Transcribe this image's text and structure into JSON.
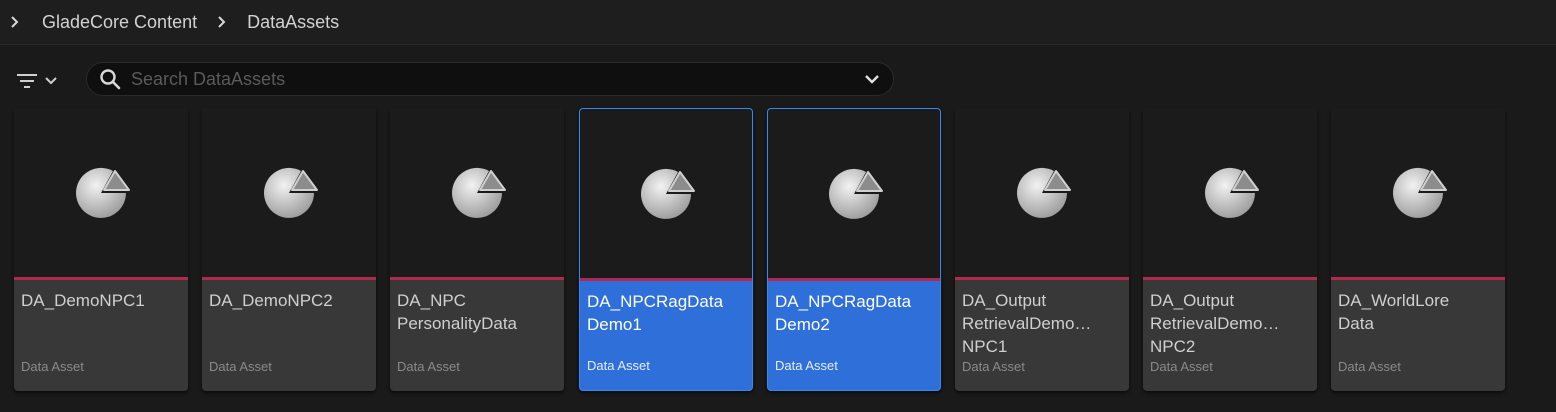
{
  "breadcrumb": {
    "items": [
      "GladeCore Content",
      "DataAssets"
    ]
  },
  "search": {
    "placeholder": "Search DataAssets",
    "value": ""
  },
  "colors": {
    "selected": "#2f6fda",
    "type_bar": "#b2294f",
    "tile_bg": "#383838"
  },
  "assets": [
    {
      "name": "DA_DemoNPC1",
      "type": "Data Asset",
      "selected": false
    },
    {
      "name": "DA_DemoNPC2",
      "type": "Data Asset",
      "selected": false
    },
    {
      "name": "DA_NPC\nPersonalityData",
      "type": "Data Asset",
      "selected": false
    },
    {
      "name": "DA_NPCRagData\nDemo1",
      "type": "Data Asset",
      "selected": true
    },
    {
      "name": "DA_NPCRagData\nDemo2",
      "type": "Data Asset",
      "selected": true
    },
    {
      "name": "DA_Output\nRetrievalDemo…\nNPC1",
      "type": "Data Asset",
      "selected": false
    },
    {
      "name": "DA_Output\nRetrievalDemo…\nNPC2",
      "type": "Data Asset",
      "selected": false
    },
    {
      "name": "DA_WorldLore\nData",
      "type": "Data Asset",
      "selected": false
    }
  ],
  "icons": {
    "crumb_separator": "chevron-right-icon",
    "filter": "filter-icon",
    "search": "search-icon",
    "search_options": "chevron-down-icon",
    "asset_thumbnail": "data-asset-pie-icon"
  }
}
